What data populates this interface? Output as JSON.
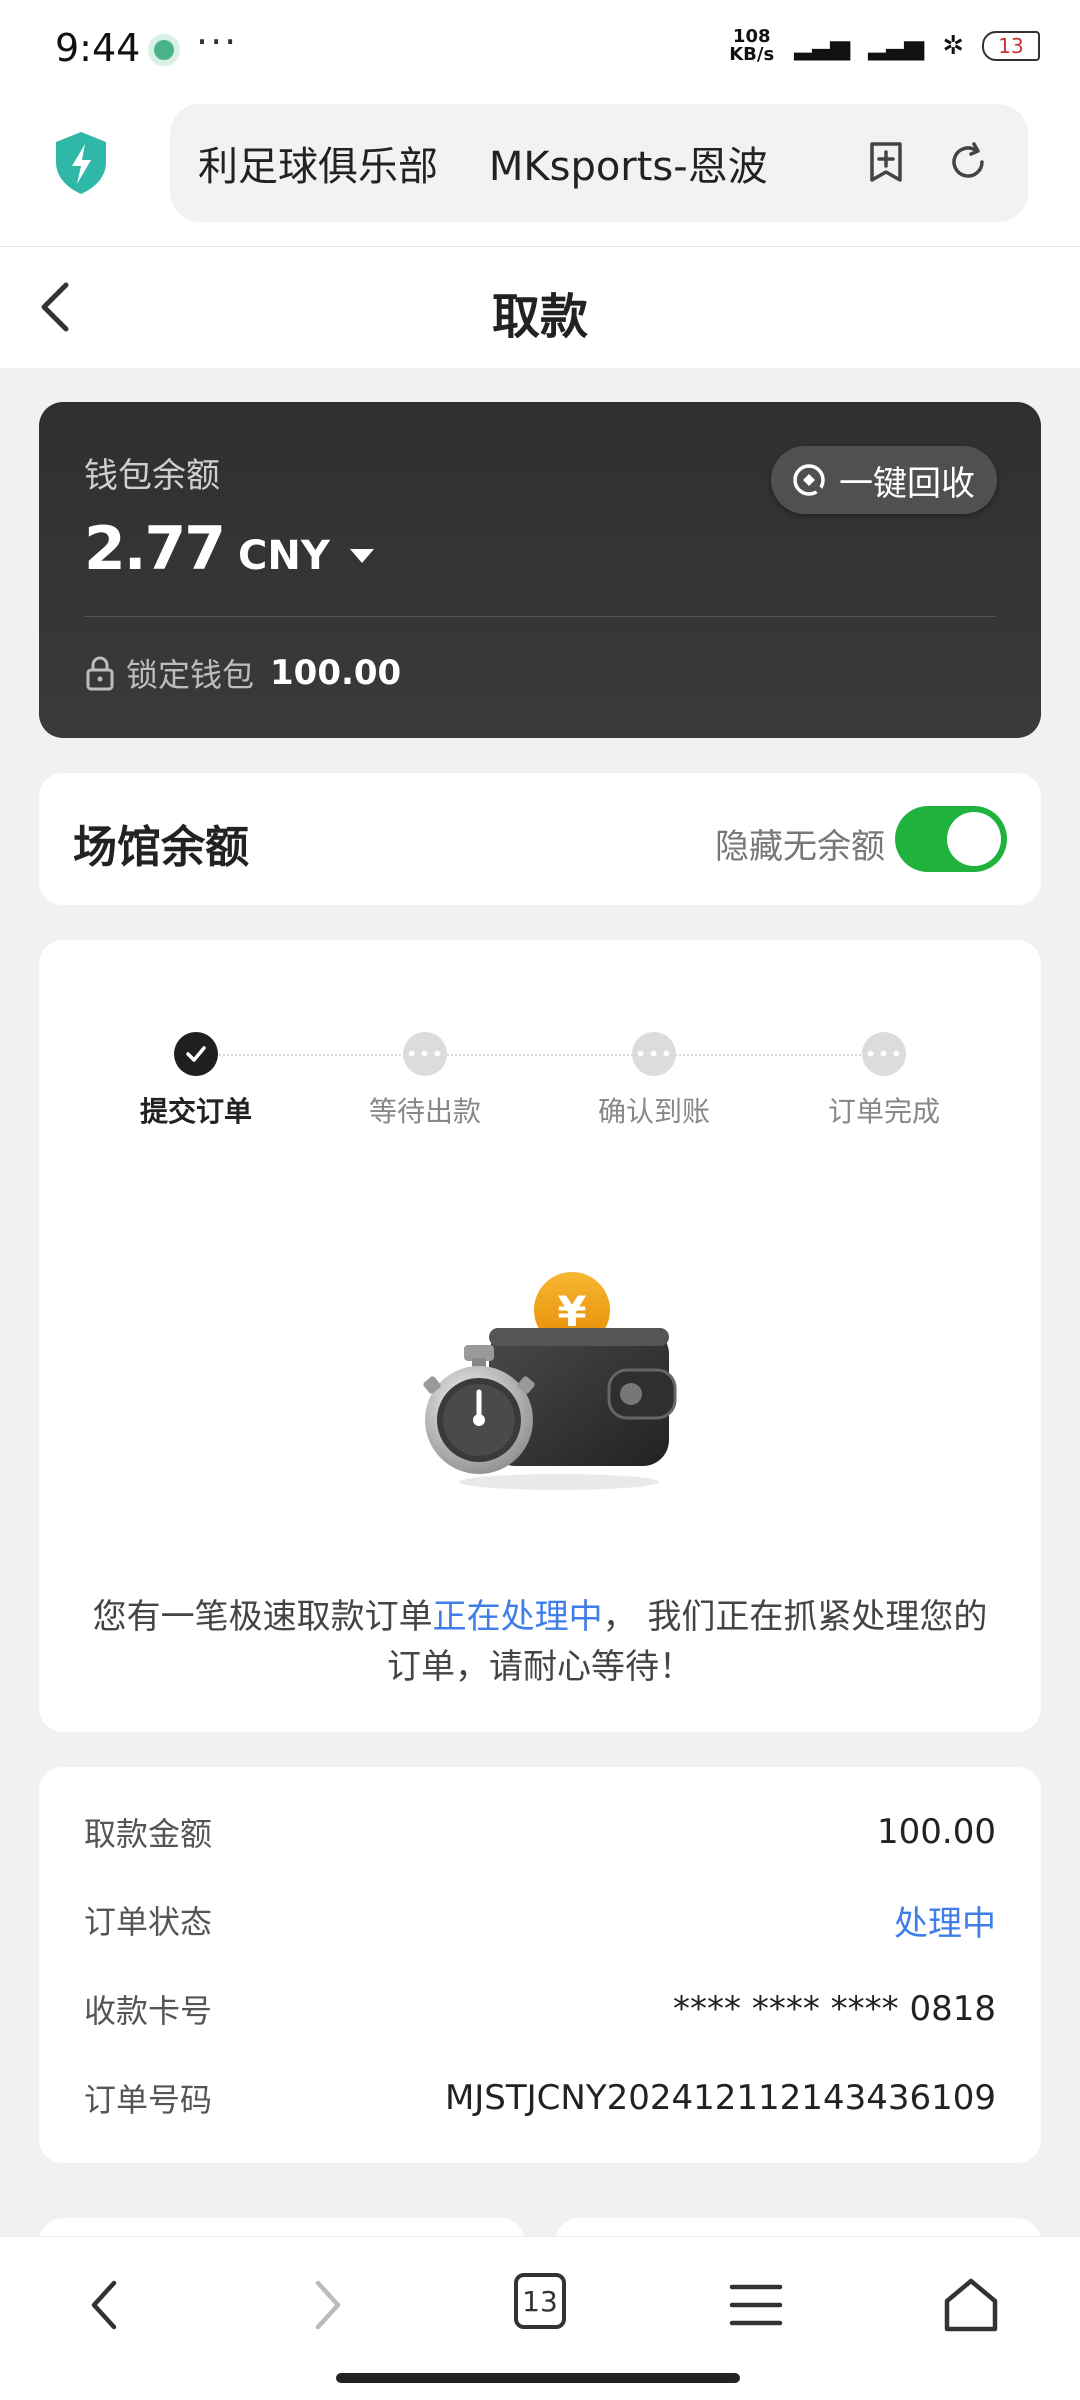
{
  "status_bar": {
    "time": "9:44",
    "more": "···",
    "speed_value": "108",
    "speed_unit": "KB/s",
    "battery": "13"
  },
  "address_bar": {
    "url_text": "利足球俱乐部    MKsports-恩波",
    "accent": "#2fb8a8"
  },
  "header": {
    "title": "取款"
  },
  "wallet": {
    "label": "钱包余额",
    "amount": "2.77",
    "currency": "CNY",
    "recycle_button": "一键回收",
    "locked_label": "锁定钱包",
    "locked_amount": "100.00"
  },
  "venue": {
    "title": "场馆余额",
    "hide_label": "隐藏无余额",
    "toggle_on": true,
    "toggle_color": "#1fb23c"
  },
  "progress": {
    "steps": [
      {
        "label": "提交订单",
        "done": true
      },
      {
        "label": "等待出款",
        "done": false
      },
      {
        "label": "确认到账",
        "done": false
      },
      {
        "label": "订单完成",
        "done": false
      }
    ],
    "message_prefix": "您有一笔极速取款订单",
    "message_highlight": "正在处理中",
    "message_suffix": "， 我们正在抓紧处理您的订单，请耐心等待！"
  },
  "details": {
    "rows": [
      {
        "key": "取款金额",
        "value": "100.00"
      },
      {
        "key": "订单状态",
        "value": "处理中"
      },
      {
        "key": "收款卡号",
        "value": "**** **** **** 0818"
      },
      {
        "key": "订单号码",
        "value": "MJSTJCNY20241211214343610​9"
      }
    ],
    "status_color": "#3f7ee8"
  },
  "bottom_nav": {
    "tab_count": "13"
  }
}
